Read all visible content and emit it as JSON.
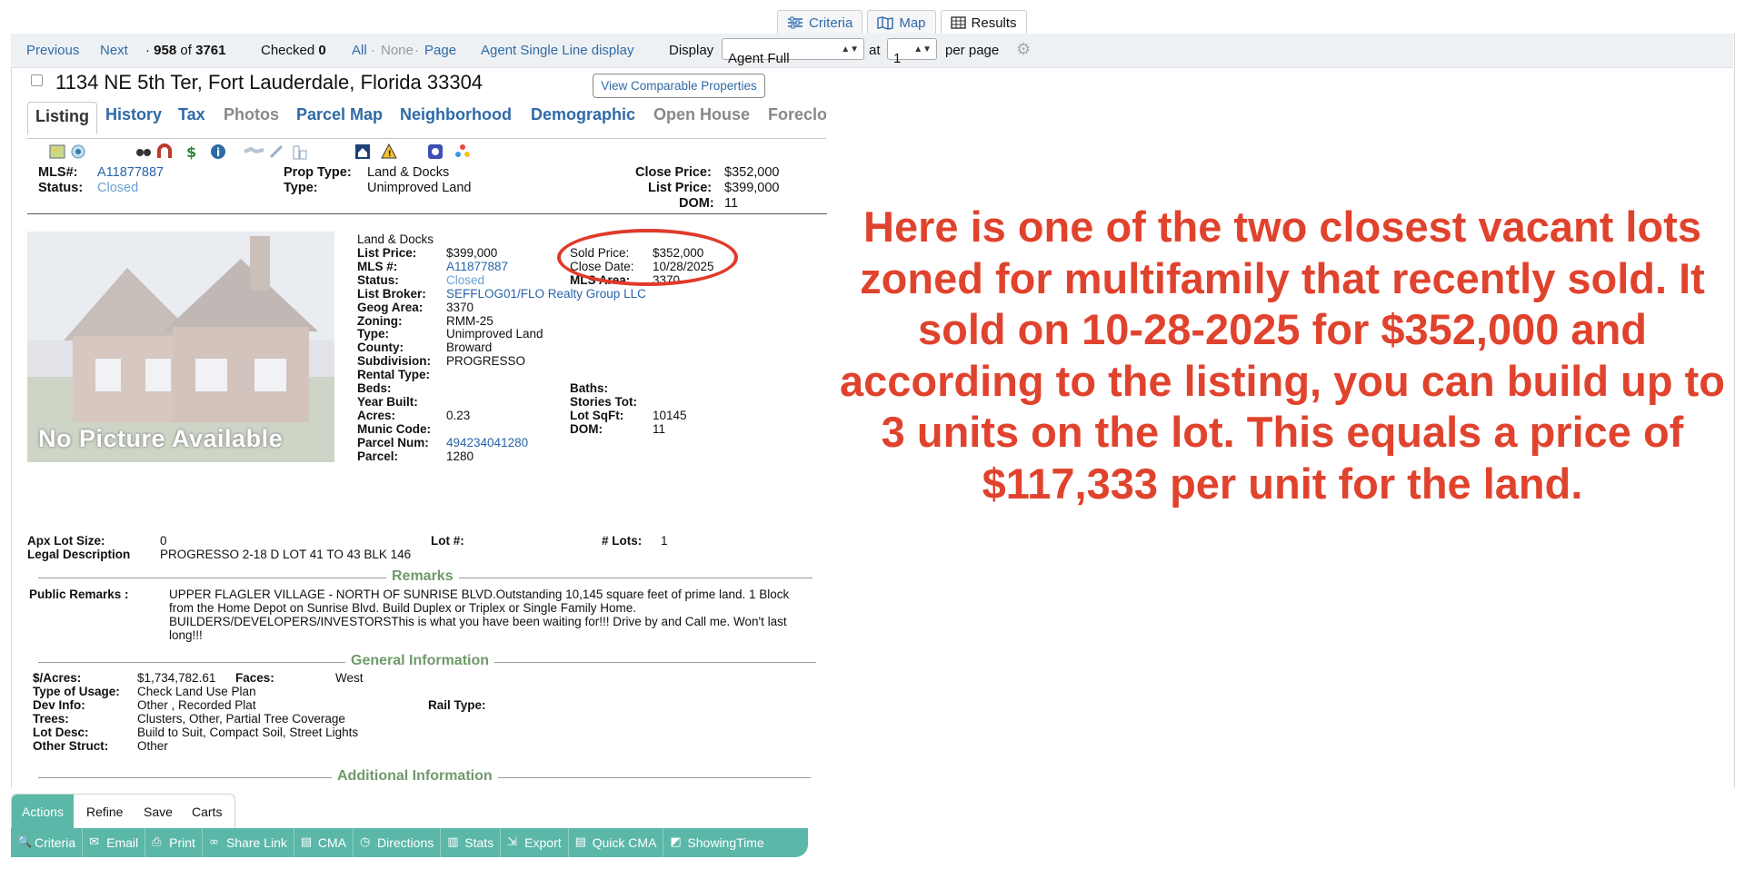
{
  "view_tabs": {
    "criteria": "Criteria",
    "map": "Map",
    "results": "Results"
  },
  "toolbar": {
    "previous": "Previous",
    "next": "Next",
    "position": "958",
    "of": "of",
    "total": "3761",
    "checked_label": "Checked",
    "checked_count": "0",
    "all": "All",
    "none": "None",
    "page": "Page",
    "sep": "·",
    "agent_single_line": "Agent Single Line display",
    "display_label": "Display",
    "display_value": "Agent Full",
    "at_label": "at",
    "at_value": "1",
    "per_page": "per page"
  },
  "listing": {
    "address": "1134 NE 5th Ter, Fort Lauderdale, Florida 33304",
    "view_comparable": "View Comparable Properties"
  },
  "tabs": [
    "Listing",
    "History",
    "Tax",
    "Photos",
    "Parcel Map",
    "Neighborhood",
    "Demographic",
    "Open House",
    "Foreclo"
  ],
  "summary": {
    "mls_label": "MLS#:",
    "mls_value": "A11877887",
    "status_label": "Status:",
    "status_value": "Closed",
    "prop_type_label": "Prop Type:",
    "prop_type_value": "Land & Docks",
    "type_label": "Type:",
    "type_value": "Unimproved Land",
    "close_price_label": "Close Price:",
    "close_price_value": "$352,000",
    "list_price_label": "List Price:",
    "list_price_value": "$399,000",
    "dom_label": "DOM:",
    "dom_value": "11"
  },
  "photo": {
    "no_picture": "No Picture Available"
  },
  "details": {
    "category": "Land & Docks",
    "left": [
      {
        "label": "List Price:",
        "value": "$399,000"
      },
      {
        "label": "MLS #:",
        "value": "A11877887",
        "link": true
      },
      {
        "label": "Status:",
        "value": "Closed",
        "muted": true
      },
      {
        "label": "List Broker:",
        "value": "SEFFLOG01/FLO Realty Group LLC",
        "link": true
      },
      {
        "label": "Geog Area:",
        "value": "3370"
      },
      {
        "label": "Zoning:",
        "value": "RMM-25"
      },
      {
        "label": "Type:",
        "value": "Unimproved Land"
      },
      {
        "label": "County:",
        "value": "Broward"
      },
      {
        "label": "Subdivision:",
        "value": "PROGRESSO"
      },
      {
        "label": "Rental Type:",
        "value": ""
      },
      {
        "label": "Beds:",
        "value": ""
      },
      {
        "label": "Year Built:",
        "value": ""
      },
      {
        "label": "Acres:",
        "value": "0.23"
      },
      {
        "label": "Munic Code:",
        "value": ""
      },
      {
        "label": "Parcel Num:",
        "value": "494234041280",
        "link": true
      },
      {
        "label": "Parcel:",
        "value": "1280"
      }
    ],
    "right_top": [
      {
        "label": "Sold Price:",
        "value": "$352,000"
      },
      {
        "label": "Close Date:",
        "value": "10/28/2025"
      },
      {
        "label": "MLS Area:",
        "value": "3370"
      }
    ],
    "right_bottom": [
      {
        "label": "Baths:",
        "value": ""
      },
      {
        "label": "Stories Tot:",
        "value": ""
      },
      {
        "label": "Lot SqFt:",
        "value": "10145"
      },
      {
        "label": "DOM:",
        "value": "11"
      }
    ]
  },
  "lot": {
    "apx_label": "Apx Lot Size:",
    "apx_value": "0",
    "lotnum_label": "Lot #:",
    "lotnum_value": "",
    "lots_label": "# Lots:",
    "lots_value": "1",
    "legal_label": "Legal Description",
    "legal_value": "PROGRESSO 2-18 D LOT 41 TO 43 BLK 146"
  },
  "remarks": {
    "title": "Remarks",
    "label": "Public Remarks :",
    "lines": [
      "UPPER FLAGLER VILLAGE - NORTH OF SUNRISE BLVD.Outstanding 10,145 square feet of prime land. 1 Block",
      "from the Home Depot on Sunrise Blvd. Build Duplex or Triplex or Single Family Home.",
      "BUILDERS/DEVELOPERS/INVESTORSThis is what you have been waiting for!!! Drive by and Call me. Won't last",
      "long!!!"
    ]
  },
  "general": {
    "title": "General Information",
    "rows": [
      {
        "label": "$/Acres:",
        "value": "$1,734,782.61"
      },
      {
        "label": "Type of Usage:",
        "value": "Check Land Use Plan"
      },
      {
        "label": "Dev Info:",
        "value": "Other , Recorded Plat"
      },
      {
        "label": "Trees:",
        "value": "Clusters, Other, Partial Tree Coverage"
      },
      {
        "label": "Lot Desc:",
        "value": "Build to Suit, Compact Soil, Street Lights"
      },
      {
        "label": "Other Struct:",
        "value": "Other"
      }
    ],
    "faces_label": "Faces:",
    "faces_value": "West",
    "rail_label": "Rail Type:",
    "rail_value": ""
  },
  "additional": {
    "title": "Additional Information"
  },
  "annotation": "Here is one of the two closest vacant lots zoned for multifamily that recently sold. It sold on 10-28-2025 for $352,000 and according to the listing, you can build up to 3 units on the lot. This equals a price of $117,333 per unit for the land.",
  "actions_tabs": [
    "Actions",
    "Refine",
    "Save",
    "Carts"
  ],
  "actions": [
    {
      "label": "Criteria",
      "icon": "search-icon"
    },
    {
      "label": "Email",
      "icon": "email-icon"
    },
    {
      "label": "Print",
      "icon": "print-icon"
    },
    {
      "label": "Share Link",
      "icon": "link-icon"
    },
    {
      "label": "CMA",
      "icon": "document-icon"
    },
    {
      "label": "Directions",
      "icon": "compass-icon"
    },
    {
      "label": "Stats",
      "icon": "chart-icon"
    },
    {
      "label": "Export",
      "icon": "export-icon"
    },
    {
      "label": "Quick CMA",
      "icon": "document-icon"
    },
    {
      "label": "ShowingTime",
      "icon": "showingtime-icon"
    }
  ],
  "colors": {
    "accent": "#2f6aa7",
    "action_bar": "#5bb7a8",
    "annotation": "#e0432d",
    "section_title": "#6f9a6a"
  }
}
